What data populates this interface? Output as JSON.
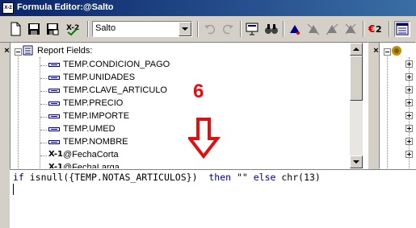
{
  "window": {
    "title": "Formula Editor:@Salto"
  },
  "toolbar": {
    "formula_name": "Salto",
    "buttons": [
      {
        "name": "new-icon"
      },
      {
        "name": "save-icon"
      },
      {
        "name": "save-all-icon"
      },
      {
        "name": "check-icon"
      },
      {
        "name": "undo-icon"
      },
      {
        "name": "redo-icon"
      },
      {
        "name": "browse-icon"
      },
      {
        "name": "find-icon"
      },
      {
        "name": "bookmark-icon"
      },
      {
        "name": "next-bookmark-icon"
      },
      {
        "name": "prev-bookmark-icon"
      },
      {
        "name": "syntax-icon"
      },
      {
        "name": "view-icon"
      }
    ],
    "check_label": "X-2",
    "syntax_label": "€2"
  },
  "tree": {
    "root_label": "Report Fields:",
    "items": [
      {
        "label": "TEMP.CONDICION_PAGO",
        "icon": "field-icon"
      },
      {
        "label": "TEMP.UNIDADES",
        "icon": "field-icon"
      },
      {
        "label": "TEMP.CLAVE_ARTICULO",
        "icon": "field-icon"
      },
      {
        "label": "TEMP.PRECIO",
        "icon": "field-icon"
      },
      {
        "label": "TEMP.IMPORTE",
        "icon": "field-icon"
      },
      {
        "label": "TEMP.UMED",
        "icon": "field-icon"
      },
      {
        "label": "TEMP.NOMBRE",
        "icon": "field-icon"
      },
      {
        "label": "@FechaCorta",
        "icon": "formula-icon"
      },
      {
        "label": "@FechaLarga",
        "icon": "formula-icon"
      }
    ],
    "formula_icon_text": "X-1"
  },
  "editor": {
    "tokens": [
      {
        "text": "if ",
        "kw": true
      },
      {
        "text": "isnull({TEMP.NOTAS_ARTICULOS})  ",
        "kw": false
      },
      {
        "text": "then ",
        "kw": true
      },
      {
        "text": "\"\" ",
        "kw": false
      },
      {
        "text": "else ",
        "kw": true
      },
      {
        "text": "chr(13)",
        "kw": false
      }
    ]
  },
  "annotation": {
    "number": "6",
    "color": "#e01010"
  },
  "colors": {
    "titlebar_start": "#0a246a",
    "titlebar_end": "#3a6ea5",
    "keyword": "#00007f"
  }
}
